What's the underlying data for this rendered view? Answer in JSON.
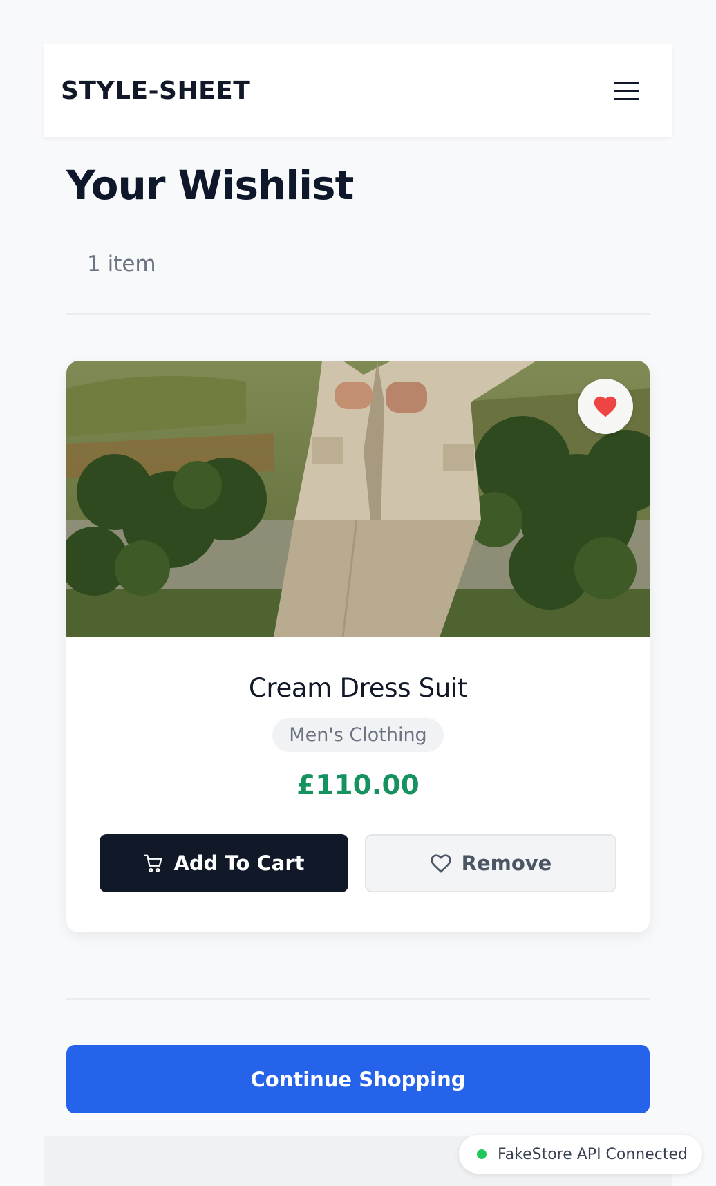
{
  "header": {
    "brand": "STYLE-SHEET",
    "menu_icon": "hamburger-menu-icon"
  },
  "wishlist": {
    "title": "Your Wishlist",
    "count_label": "1 item"
  },
  "items": [
    {
      "name": "Cream Dress Suit",
      "category": "Men's Clothing",
      "price": "£110.00",
      "image_icon": "product-photo",
      "wish_icon": "heart-filled-icon",
      "add_to_cart_label": "Add To Cart",
      "add_to_cart_icon": "cart-icon",
      "remove_label": "Remove",
      "remove_icon": "heart-outline-icon"
    }
  ],
  "continue_label": "Continue Shopping",
  "api_status": {
    "label": "FakeStore API Connected",
    "status_color": "#22c55e"
  },
  "colors": {
    "primary": "#2563eb",
    "dark_button": "#111827",
    "price": "#15935f",
    "heart": "#ef4444"
  }
}
